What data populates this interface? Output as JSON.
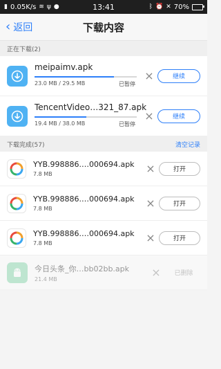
{
  "status_bar": {
    "speed": "0.05K/s",
    "time": "13:41",
    "battery": "70%",
    "battery_level": 0.7
  },
  "nav": {
    "back_label": "返回",
    "title": "下载内容"
  },
  "downloading": {
    "header": "正在下载(2)",
    "items": [
      {
        "name": "meipaimv.apk",
        "size": "23.0 MB / 29.5 MB",
        "status": "已暂停",
        "progress": 0.78,
        "action": "继续",
        "icon": "download-icon"
      },
      {
        "name": "TencentVideo…321_87.apk",
        "size": "19.4 MB / 38.0 MB",
        "status": "已暂停",
        "progress": 0.51,
        "action": "继续",
        "icon": "download-icon"
      }
    ]
  },
  "completed": {
    "header": "下载完成(57)",
    "clear_label": "清空记录",
    "items": [
      {
        "name": "YYB.998886.…000694.apk",
        "size": "7.8 MB",
        "action": "打开",
        "icon": "yyb-app-icon"
      },
      {
        "name": "YYB.998886.…000694.apk",
        "size": "7.8 MB",
        "action": "打开",
        "icon": "yyb-app-icon"
      },
      {
        "name": "YYB.998886.…000694.apk",
        "size": "7.8 MB",
        "action": "打开",
        "icon": "yyb-app-icon"
      },
      {
        "name": "今日头条_你…bb02bb.apk",
        "size": "21.4 MB",
        "status": "已删除",
        "icon": "android-icon"
      }
    ]
  },
  "colors": {
    "accent": "#2d7ff9",
    "download_icon_bg": "#4fb2f3",
    "android_icon_bg": "#7dd3a6"
  }
}
